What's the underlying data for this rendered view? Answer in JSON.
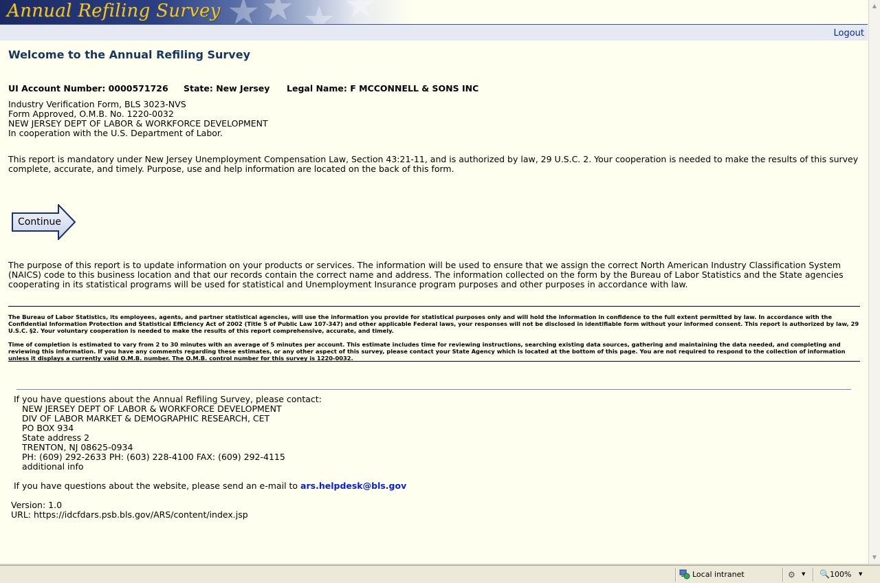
{
  "banner": {
    "title": "Annual Refiling Survey"
  },
  "nav": {
    "logout": "Logout"
  },
  "page": {
    "heading": "Welcome to the Annual Refiling Survey",
    "account": {
      "ui_account": "UI Account Number: 0000571726",
      "state": "State: New Jersey",
      "legal_name": "Legal Name: F MCCONNELL & SONS INC"
    },
    "form_info": [
      "Industry Verification Form, BLS 3023-NVS",
      "Form Approved, O.M.B. No. 1220-0032",
      "NEW JERSEY DEPT OF LABOR & WORKFORCE DEVELOPMENT",
      "In cooperation with the U.S. Department of Labor."
    ],
    "mandatory_text": "This report is mandatory under New Jersey Unemployment Compensation Law, Section 43:21-11, and is authorized by law, 29 U.S.C. 2. Your cooperation is needed to make the results of this survey complete, accurate, and timely. Purpose, use and help information are located on the back of this form.",
    "continue_label": "Continue",
    "purpose_text": "The purpose of this report is to update information on your products or services. The information will be used to ensure that we assign the correct North American Industry Classification System (NAICS) code to this business location and that our records contain the correct name and address. The information collected on the form by the Bureau of Labor Statistics and the State agencies cooperating in its statistical programs will be used for statistical and Unemployment Insurance program purposes and other purposes in accordance with law.",
    "confidentiality_text": "The Bureau of Labor Statistics, its employees, agents, and partner statistical agencies, will use the information you provide for statistical purposes only and will hold the information in confidence to the full extent permitted by law. In accordance with the Confidential Information Protection and Statistical Efficiency Act of 2002 (Title 5 of Public Law 107-347) and other applicable Federal laws, your responses will not be disclosed in identifiable form without your informed consent. This report is authorized by law, 29 U.S.C. §2. Your voluntary cooperation is needed to make the results of this report comprehensive, accurate, and timely.",
    "burden_text": "Time of completion is estimated to vary from 2 to 30 minutes with an average of 5 minutes per account. This estimate includes time for reviewing instructions, searching existing data sources, gathering and maintaining the data needed, and completing and reviewing this information. If you have any comments regarding these estimates, or any other aspect of this survey, please contact your State Agency which is located at the bottom of this page. You are not required to respond to the collection of information unless it displays a currently valid O.M.B. number. The O.M.B. control number for this survey is 1220-0032."
  },
  "contact": {
    "intro": "If you have questions about the Annual Refiling Survey, please contact:",
    "lines": [
      "NEW JERSEY DEPT OF LABOR & WORKFORCE DEVELOPMENT",
      "DIV OF LABOR MARKET & DEMOGRAPHIC RESEARCH, CET",
      "PO BOX 934",
      "State address 2",
      "TRENTON, NJ 08625-0934",
      "PH: (609) 292-2633  PH: (603) 228-4100  FAX: (609) 292-4115",
      "additional info"
    ],
    "website_prefix": "If you have questions about the website, please send an e-mail to",
    "helpdesk_email": "ars.helpdesk@bls.gov",
    "version": "Version: 1.0",
    "url": "URL: https://idcfdars.psb.bls.gov/ARS/content/index.jsp"
  },
  "statusbar": {
    "zone": "Local intranet",
    "zoom": "100%"
  }
}
